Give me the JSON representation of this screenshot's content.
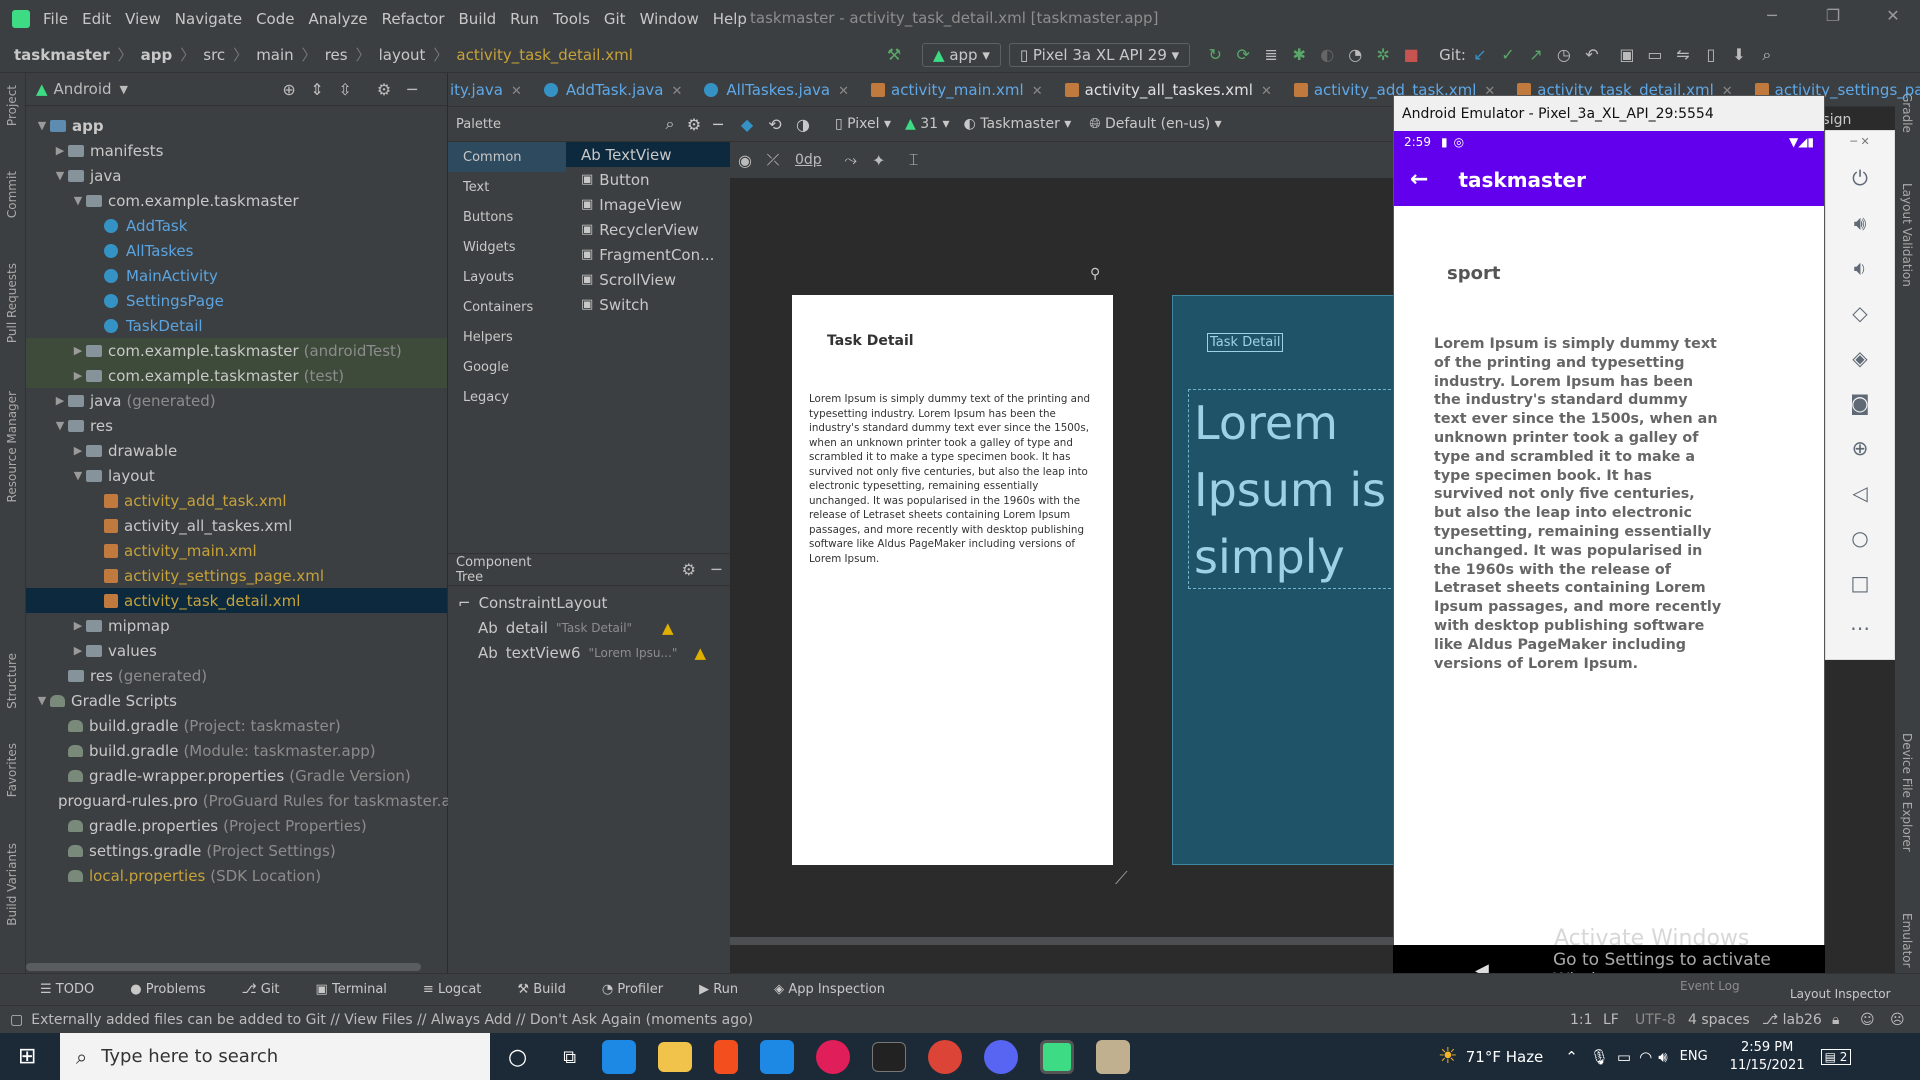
{
  "menubar": {
    "items": [
      "File",
      "Edit",
      "View",
      "Navigate",
      "Code",
      "Analyze",
      "Refactor",
      "Build",
      "Run",
      "Tools",
      "Git",
      "Window",
      "Help"
    ],
    "title": "taskmaster - activity_task_detail.xml [taskmaster.app]"
  },
  "navbar": {
    "breadcrumbs": [
      "taskmaster",
      "app",
      "src",
      "main",
      "res",
      "layout",
      "activity_task_detail.xml"
    ],
    "run_config": "app",
    "device": "Pixel 3a XL API 29",
    "git_label": "Git:"
  },
  "left_strip": [
    "Project",
    "Commit",
    "Pull Requests",
    "Resource Manager",
    "Structure",
    "Favorites",
    "Build Variants"
  ],
  "right_strip": [
    "Gradle",
    "Layout Validation",
    "Device File Explorer",
    "Emulator"
  ],
  "project": {
    "view": "Android",
    "tree": [
      {
        "label": "app",
        "depth": 0,
        "kind": "app",
        "arrow": "▼"
      },
      {
        "label": "manifests",
        "depth": 1,
        "kind": "folder",
        "arrow": "▶"
      },
      {
        "label": "java",
        "depth": 1,
        "kind": "folder",
        "arrow": "▼"
      },
      {
        "label": "com.example.taskmaster",
        "depth": 2,
        "kind": "folder",
        "arrow": "▼"
      },
      {
        "label": "AddTask",
        "depth": 3,
        "kind": "class"
      },
      {
        "label": "AllTaskes",
        "depth": 3,
        "kind": "class"
      },
      {
        "label": "MainActivity",
        "depth": 3,
        "kind": "class"
      },
      {
        "label": "SettingsPage",
        "depth": 3,
        "kind": "class"
      },
      {
        "label": "TaskDetail",
        "depth": 3,
        "kind": "class"
      },
      {
        "label": "com.example.taskmaster",
        "suffix": "(androidTest)",
        "depth": 2,
        "kind": "folder",
        "arrow": "▶",
        "olive": true
      },
      {
        "label": "com.example.taskmaster",
        "suffix": "(test)",
        "depth": 2,
        "kind": "folder",
        "arrow": "▶",
        "olive": true
      },
      {
        "label": "java",
        "suffix": "(generated)",
        "depth": 1,
        "kind": "folder",
        "arrow": "▶"
      },
      {
        "label": "res",
        "depth": 1,
        "kind": "folder",
        "arrow": "▼"
      },
      {
        "label": "drawable",
        "depth": 2,
        "kind": "folder",
        "arrow": "▶"
      },
      {
        "label": "layout",
        "depth": 2,
        "kind": "folder",
        "arrow": "▼"
      },
      {
        "label": "activity_add_task.xml",
        "depth": 3,
        "kind": "xml",
        "color": "orange"
      },
      {
        "label": "activity_all_taskes.xml",
        "depth": 3,
        "kind": "xml"
      },
      {
        "label": "activity_main.xml",
        "depth": 3,
        "kind": "xml",
        "color": "orange"
      },
      {
        "label": "activity_settings_page.xml",
        "depth": 3,
        "kind": "xml",
        "color": "orange"
      },
      {
        "label": "activity_task_detail.xml",
        "depth": 3,
        "kind": "xml",
        "color": "orange",
        "selected": true
      },
      {
        "label": "mipmap",
        "depth": 2,
        "kind": "folder",
        "arrow": "▶"
      },
      {
        "label": "values",
        "depth": 2,
        "kind": "folder",
        "arrow": "▶"
      },
      {
        "label": "res",
        "suffix": "(generated)",
        "depth": 1,
        "kind": "folder"
      },
      {
        "label": "Gradle Scripts",
        "depth": 0,
        "kind": "gradle",
        "arrow": "▼"
      },
      {
        "label": "build.gradle",
        "suffix": "(Project: taskmaster)",
        "depth": 1,
        "kind": "gradle"
      },
      {
        "label": "build.gradle",
        "suffix": "(Module: taskmaster.app)",
        "depth": 1,
        "kind": "gradle"
      },
      {
        "label": "gradle-wrapper.properties",
        "suffix": "(Gradle Version)",
        "depth": 1,
        "kind": "gradle"
      },
      {
        "label": "proguard-rules.pro",
        "suffix": "(ProGuard Rules for taskmaster.a",
        "depth": 1,
        "kind": "gradle"
      },
      {
        "label": "gradle.properties",
        "suffix": "(Project Properties)",
        "depth": 1,
        "kind": "gradle"
      },
      {
        "label": "settings.gradle",
        "suffix": "(Project Settings)",
        "depth": 1,
        "kind": "gradle"
      },
      {
        "label": "local.properties",
        "suffix": "(SDK Location)",
        "depth": 1,
        "kind": "gradle",
        "color": "orange"
      }
    ]
  },
  "tabs": [
    "ity.java",
    "AddTask.java",
    "AllTaskes.java",
    "activity_main.xml",
    "activity_all_taskes.xml",
    "activity_add_task.xml",
    "activity_task_detail.xml",
    "activity_settings_page.xml"
  ],
  "design_label": "Design",
  "palette": {
    "title": "Palette",
    "categories": [
      "Common",
      "Text",
      "Buttons",
      "Widgets",
      "Layouts",
      "Containers",
      "Helpers",
      "Google",
      "Legacy"
    ],
    "items": [
      "Ab TextView",
      "Button",
      "ImageView",
      "RecyclerView",
      "FragmentCon...",
      "ScrollView",
      "Switch"
    ]
  },
  "design_toolbar": {
    "device": "Pixel",
    "api": "31",
    "theme": "Taskmaster",
    "locale": "Default (en-us)",
    "margin": "0dp"
  },
  "component_tree": {
    "title": "Component Tree",
    "root": "ConstraintLayout",
    "children": [
      {
        "id": "detail",
        "text": "\"Task Detail\""
      },
      {
        "id": "textView6",
        "text": "\"Lorem Ipsu...\""
      }
    ]
  },
  "preview": {
    "title": "Task Detail",
    "body": "Lorem Ipsum is simply dummy text of the printing and typesetting industry. Lorem Ipsum has been the industry's standard dummy text ever since the 1500s, when an unknown printer took a galley of type and scrambled it to make a type specimen book. It has survived not only five centuries, but also the leap into electronic typesetting, remaining essentially unchanged. It was popularised in the 1960s with the release of Letraset sheets containing Lorem Ipsum passages, and more recently with desktop publishing software like Aldus PageMaker including versions of Lorem Ipsum.",
    "blueprint_title": "Task Detail",
    "blueprint_big": "Lorem Ipsum is simply"
  },
  "emulator": {
    "window_title": "Android Emulator - Pixel_3a_XL_API_29:5554",
    "time": "2:59",
    "app_title": "taskmaster",
    "heading": "sport",
    "body": "Lorem Ipsum is simply dummy text of the printing and typesetting industry. Lorem Ipsum has been the industry's standard dummy text ever since the 1500s, when an unknown printer took a galley of type and scrambled it to make a type specimen book. It has survived not only five centuries, but also the leap into electronic typesetting, remaining essentially unchanged. It was popularised in the 1960s with the release of Letraset sheets containing Lorem Ipsum passages, and more recently with desktop publishing software like Aldus PageMaker including versions of Lorem Ipsum.",
    "watermark1": "Activate Windows",
    "watermark2": "Go to Settings to activate Windows."
  },
  "bottom_tools": [
    "TODO",
    "Problems",
    "Git",
    "Terminal",
    "Logcat",
    "Build",
    "Profiler",
    "Run",
    "App Inspection"
  ],
  "bottom_right": [
    "Event Log",
    "Layout Inspector"
  ],
  "statusbar": {
    "message": "Externally added files can be added to Git // View Files // Always Add // Don't Ask Again (moments ago)",
    "pos": "1:1",
    "lf": "LF",
    "enc": "UTF-8",
    "indent": "4 spaces",
    "branch": "lab26"
  },
  "taskbar": {
    "search_placeholder": "Type here to search",
    "weather": "71°F  Haze",
    "lang": "ENG",
    "time": "2:59 PM",
    "date": "11/15/2021",
    "notif": "2"
  }
}
